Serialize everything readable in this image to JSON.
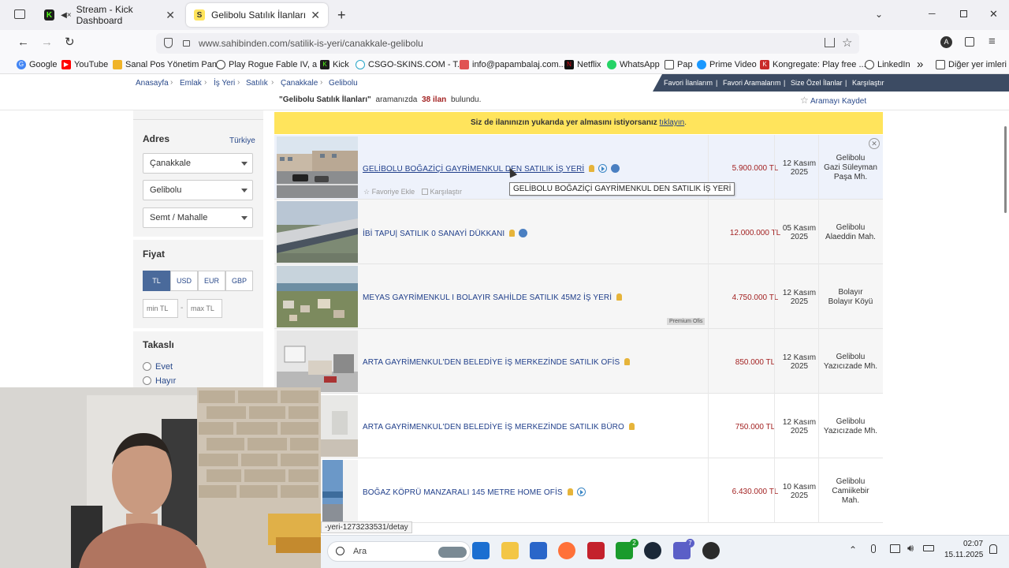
{
  "browser": {
    "tabs": [
      {
        "label": "Stream - Kick Dashboard"
      },
      {
        "label": "Gelibolu Satılık İlanları"
      }
    ],
    "url": "www.sahibinden.com/satilik-is-yeri/canakkale-gelibolu",
    "bookmarks": [
      "Google",
      "YouTube",
      "Sanal Pos Yönetim Pan...",
      "Play Rogue Fable IV, a ...",
      "Kick",
      "CSGO-SKINS.COM - T...",
      "info@papambalaj.com...",
      "Netflix",
      "WhatsApp",
      "Pap",
      "Prime Video",
      "Kongregate: Play free ...",
      "LinkedIn"
    ],
    "other_bookmarks": "Diğer yer imleri",
    "bookmarks_overflow": "»",
    "profile_initial": "A"
  },
  "breadcrumb": [
    "Anasayfa",
    "Emlak",
    "İş Yeri",
    "Satılık",
    "Çanakkale",
    "Gelibolu"
  ],
  "topnav": [
    "Favori İlanlarım",
    "Favori Aramalarım",
    "Size Özel İlanlar",
    "Karşılaştır"
  ],
  "results": {
    "query": "\"Gelibolu Satılık İlanları\"",
    "middle": "aramanızda",
    "count": "38 ilan",
    "suffix": "bulundu.",
    "save_search": "Aramayı Kaydet"
  },
  "sidebar": {
    "address_title": "Adres",
    "country_link": "Türkiye",
    "province": "Çanakkale",
    "district": "Gelibolu",
    "neighborhood": "Semt / Mahalle",
    "price_title": "Fiyat",
    "currencies": [
      "TL",
      "USD",
      "EUR",
      "GBP"
    ],
    "min_placeholder": "min TL",
    "dash": "-",
    "max_placeholder": "max TL",
    "trade_title": "Takaslı",
    "options": [
      "Evet",
      "Hayır"
    ]
  },
  "banner": {
    "text": "Siz de ilanınızın yukarıda yer almasını istiyorsanız",
    "link": "tıklayın",
    "end": "."
  },
  "listings": [
    {
      "title": "GELİBOLU BOĞAZİÇİ GAYRİMENKUL DEN SATILIK İŞ YERİ",
      "price": "5.900.000 TL",
      "date1": "12 Kasım",
      "date2": "2025",
      "loc": [
        "Gelibolu",
        "Gazi Süleyman",
        "Paşa Mh."
      ],
      "fav": "Favoriye Ekle",
      "compare": "Karşılaştır",
      "premium": ""
    },
    {
      "title": "İBİ TAPU| SATILIK 0 SANAYİ DÜKKANI",
      "price": "12.000.000 TL",
      "date1": "05 Kasım",
      "date2": "2025",
      "loc": [
        "Gelibolu",
        "Alaeddin Mah.",
        ""
      ],
      "premium": ""
    },
    {
      "title": "MEYAS GAYRİMENKUL I BOLAYIR SAHİLDE SATILIK 45M2 İŞ YERİ",
      "price": "4.750.000 TL",
      "date1": "12 Kasım",
      "date2": "2025",
      "loc": [
        "Bolayır",
        "Bolayır Köyü",
        ""
      ],
      "premium": "Premium Ofis"
    },
    {
      "title": "ARTA GAYRİMENKUL'DEN BELEDİYE İŞ MERKEZİNDE SATILIK OFİS",
      "price": "850.000 TL",
      "date1": "12 Kasım",
      "date2": "2025",
      "loc": [
        "Gelibolu",
        "Yazıcızade Mh.",
        ""
      ],
      "premium": ""
    },
    {
      "title": "ARTA GAYRİMENKUL'DEN BELEDİYE İŞ MERKEZİNDE SATILIK BÜRO",
      "price": "750.000 TL",
      "date1": "12 Kasım",
      "date2": "2025",
      "loc": [
        "Gelibolu",
        "Yazıcızade Mh.",
        ""
      ],
      "premium": ""
    },
    {
      "title": "BOĞAZ KÖPRÜ MANZARALI 145 METRE HOME OFİS",
      "price": "6.430.000 TL",
      "date1": "10 Kasım",
      "date2": "2025",
      "loc": [
        "Gelibolu",
        "Camiikebir",
        "Mah."
      ],
      "premium": ""
    }
  ],
  "tooltip": "GELİBOLU BOĞAZİÇİ GAYRİMENKUL DEN SATILIK İŞ YERİ",
  "status_url": "-yeri-1273233531/detay",
  "taskbar": {
    "search_placeholder": "Ara",
    "time": "02:07",
    "date": "15.11.2025",
    "badge_xbox": "2",
    "badge_teams": "7"
  },
  "colors": {
    "accent_yellow": "#ffe45c",
    "link_blue": "#1f3e8a",
    "price_red": "#a32323",
    "topnav_bg": "#3c4b63"
  }
}
